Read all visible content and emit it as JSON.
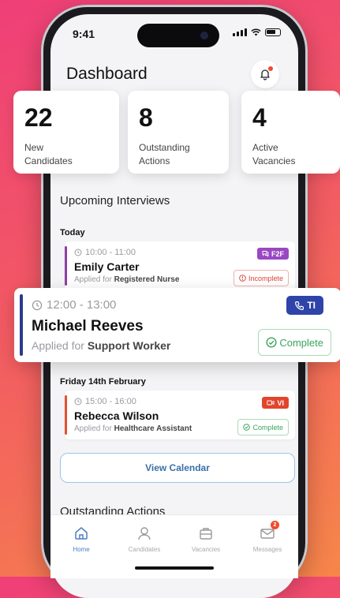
{
  "status_bar": {
    "time": "9:41"
  },
  "header": {
    "title": "Dashboard"
  },
  "stats": [
    {
      "value": "22",
      "label_line1": "New",
      "label_line2": "Candidates"
    },
    {
      "value": "8",
      "label_line1": "Outstanding",
      "label_line2": "Actions"
    },
    {
      "value": "4",
      "label_line1": "Active",
      "label_line2": "Vacancies"
    }
  ],
  "interviews": {
    "heading": "Upcoming Interviews",
    "groups": [
      {
        "day": "Today",
        "items": [
          {
            "time": "10:00 - 11:00",
            "name": "Emily Carter",
            "applied_prefix": "Applied for",
            "role": "Registered Nurse",
            "type": "F2F",
            "status": "Incomplete",
            "accent": "#8e3fa8",
            "tag_color": "#9a48c2"
          },
          {
            "time": "12:00 - 13:00",
            "name": "Michael Reeves",
            "applied_prefix": "Applied for",
            "role": "Support Worker",
            "type": "TI",
            "status": "Complete",
            "accent": "#2b3a8f",
            "tag_color": "#2f44a8"
          }
        ]
      },
      {
        "day": "Friday 14th February",
        "items": [
          {
            "time": "15:00 - 16:00",
            "name": "Rebecca Wilson",
            "applied_prefix": "Applied for",
            "role": "Healthcare Assistant",
            "type": "VI",
            "status": "Complete",
            "accent": "#e2522e",
            "tag_color": "#e2452b"
          }
        ]
      }
    ],
    "view_calendar": "View Calendar"
  },
  "outstanding_heading": "Outstanding Actions",
  "nav": [
    {
      "label": "Home",
      "icon": "home-icon",
      "active": true
    },
    {
      "label": "Candidates",
      "icon": "user-icon",
      "active": false
    },
    {
      "label": "Vacancies",
      "icon": "briefcase-icon",
      "active": false
    },
    {
      "label": "Messages",
      "icon": "mail-icon",
      "active": false,
      "badge": "2"
    }
  ],
  "colors": {
    "complete": "#3aa55c",
    "incomplete": "#e0443a",
    "primary": "#4d7fc4"
  }
}
